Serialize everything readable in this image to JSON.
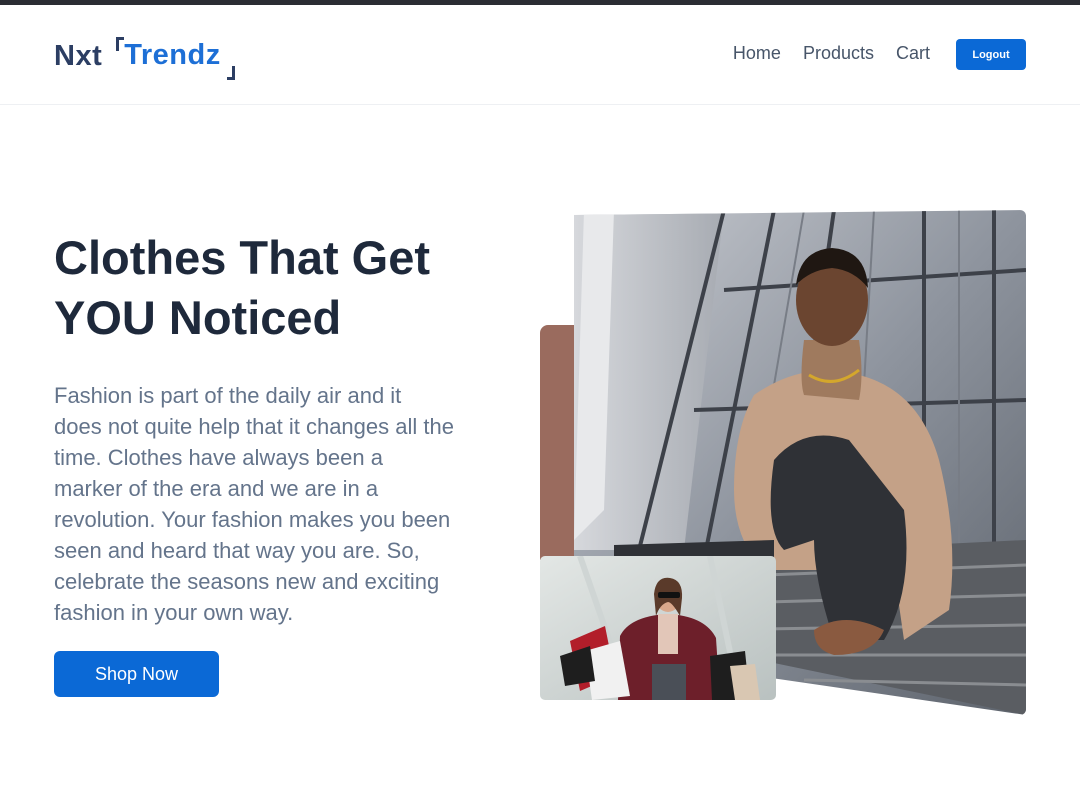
{
  "navbar": {
    "logo_part1": "Nxt",
    "logo_part2": "Trendz",
    "links": [
      "Home",
      "Products",
      "Cart"
    ],
    "logout_label": "Logout"
  },
  "hero": {
    "heading": "Clothes That Get YOU Noticed",
    "description": "Fashion is part of the daily air and it does not quite help that it changes all the time. Clothes have always been a marker of the era and we are in a revolution. Your fashion makes you been seen and heard that way you are. So, celebrate the seasons new and exciting fashion in your own way.",
    "cta_label": "Shop Now"
  },
  "colors": {
    "primary": "#0b69d6",
    "heading": "#1e293b",
    "text": "#64748b",
    "accent_brown": "#9a6b5e"
  }
}
